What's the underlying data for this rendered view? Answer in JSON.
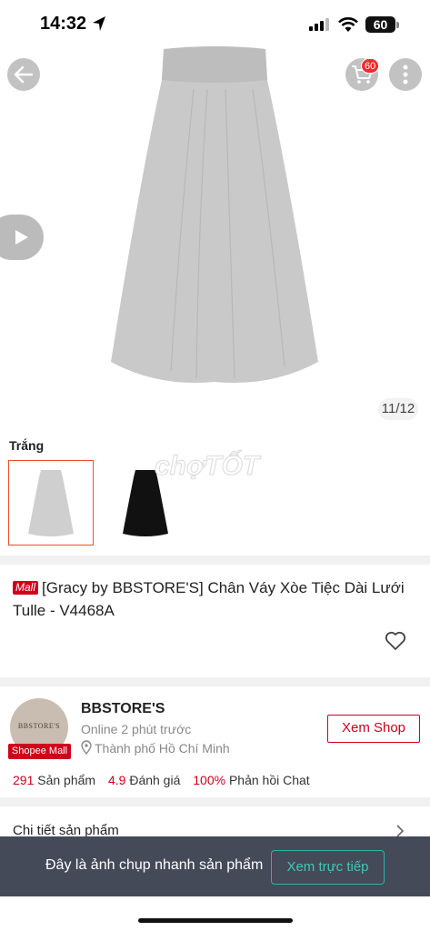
{
  "status_bar": {
    "time": "14:32",
    "battery": "60"
  },
  "image_viewer": {
    "counter": "11/12",
    "cart_count": "60"
  },
  "variants": {
    "label": "Trắng"
  },
  "watermark": "chợTỐT",
  "product": {
    "mall_badge": "Mall",
    "title": "[Gracy by BBSTORE'S] Chân Váy Xòe Tiệc Dài Lưới Tulle - V4468A"
  },
  "shop": {
    "avatar_text": "BBSTORE'S",
    "mall_badge": "Shopee Mall",
    "name": "BBSTORE'S",
    "online": "Online 2 phút trước",
    "location": "Thành phố Hồ Chí Minh",
    "view_shop": "Xem Shop",
    "stats": [
      {
        "value": "291",
        "label": "Sản phẩm"
      },
      {
        "value": "4.9",
        "label": "Đánh giá"
      },
      {
        "value": "100%",
        "label": "Phản hồi Chat"
      }
    ]
  },
  "details": {
    "title": "Chi tiết sản phẩm"
  },
  "snapshot": {
    "text": "Đây là ảnh chụp nhanh sản phẩm",
    "live_button": "Xem trực tiếp"
  }
}
